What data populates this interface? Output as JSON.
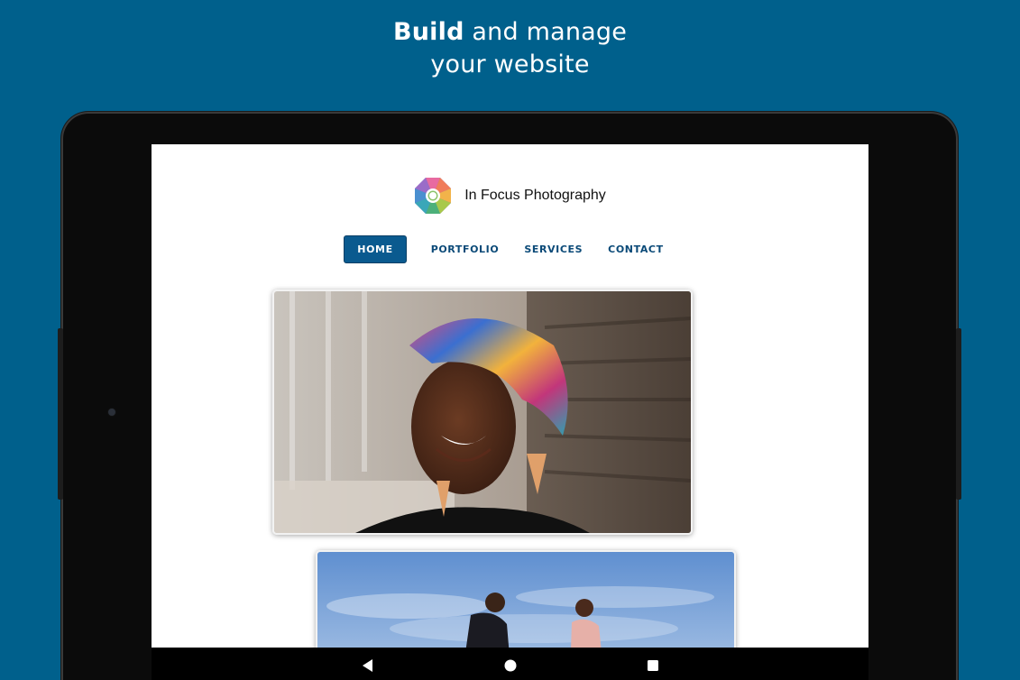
{
  "headline": {
    "bold": "Build",
    "rest_line1": " and manage",
    "line2": "your website"
  },
  "site": {
    "name": "In Focus Photography",
    "nav": [
      {
        "label": "HOME",
        "active": true
      },
      {
        "label": "PORTFOLIO",
        "active": false
      },
      {
        "label": "SERVICES",
        "active": false
      },
      {
        "label": "CONTACT",
        "active": false
      }
    ]
  },
  "icons": {
    "logo": "multicolor-octagon-logo",
    "back": "back-triangle-icon",
    "home": "home-circle-icon",
    "recent": "recent-square-icon"
  },
  "colors": {
    "background": "#00608c",
    "nav_active_bg": "#0a5a8f",
    "nav_text": "#0b4a78"
  }
}
